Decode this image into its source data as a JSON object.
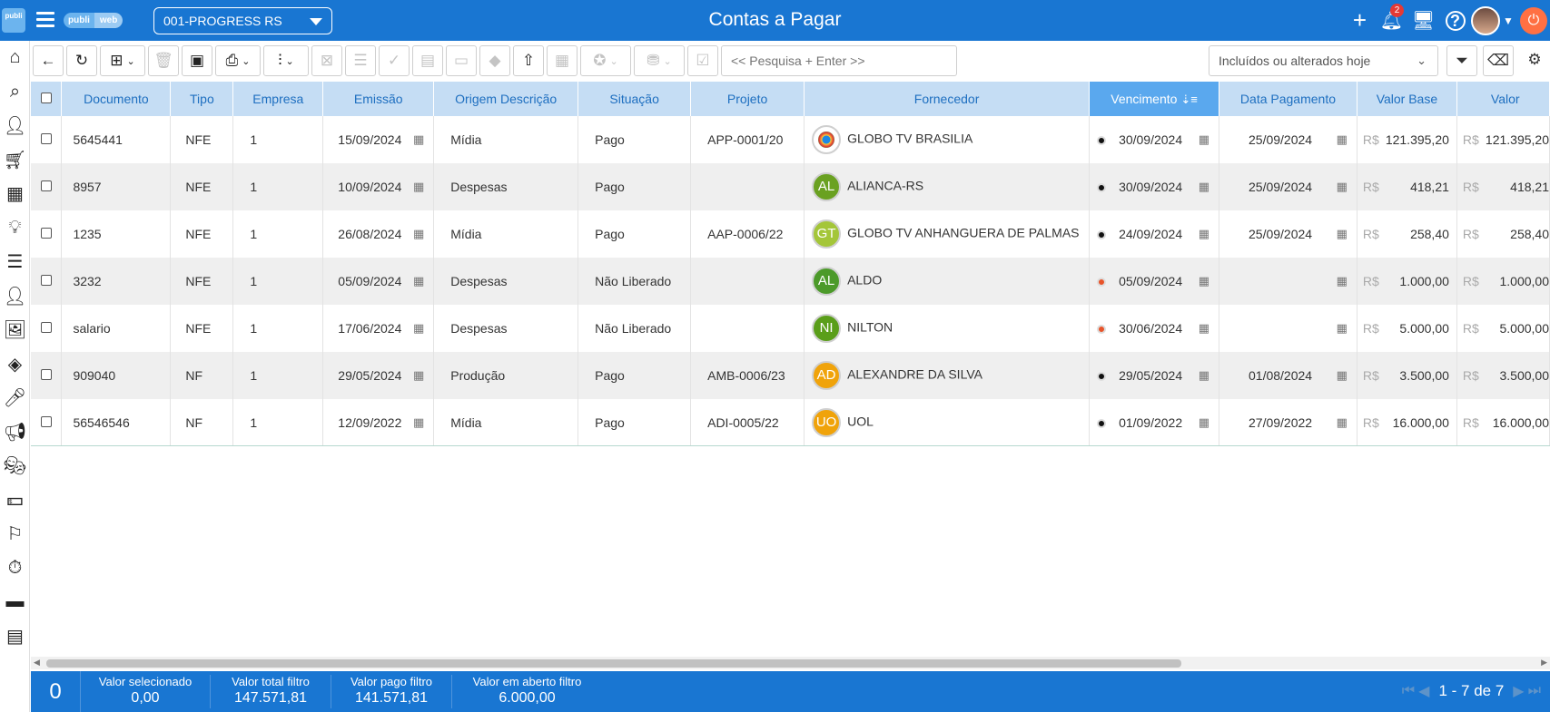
{
  "header": {
    "logo_text": "publi",
    "brand_part1": "publi",
    "brand_part2": "web",
    "company": "001-PROGRESS RS",
    "title": "Contas a Pagar",
    "notification_count": "2"
  },
  "sidebar_icons": [
    "home-icon",
    "home-search-icon",
    "add-user-icon",
    "cart-icon",
    "dashboard-icon",
    "lightbulb-icon",
    "list-icon",
    "person-icon",
    "images-icon",
    "paint-bucket-icon",
    "microphone-icon",
    "megaphone-icon",
    "theater-masks-icon",
    "money-bill-icon",
    "flag-icon",
    "stopwatch-icon",
    "wallet-icon",
    "calculator-icon"
  ],
  "toolbar": {
    "search_placeholder": "<< Pesquisa + Enter >>",
    "filter_value": "Incluídos ou alterados hoje"
  },
  "columns": [
    "Documento",
    "Tipo",
    "Empresa",
    "Emissão",
    "Origem Descrição",
    "Situação",
    "Projeto",
    "Fornecedor",
    "Vencimento",
    "Data Pagamento",
    "Valor Base",
    "Valor"
  ],
  "currency": "R$",
  "rows": [
    {
      "doc": "5645441",
      "tipo": "NFE",
      "empresa": "1",
      "emissao": "15/09/2024",
      "origem": "Mídia",
      "situacao": "Pago",
      "projeto": "APP-0001/20",
      "initials": "",
      "avatar_color": "#ffffff",
      "fornecedor": "GLOBO TV BRASILIA",
      "status_color": "#111111",
      "vencimento": "30/09/2024",
      "pagamento": "25/09/2024",
      "valor_base": "121.395,20",
      "valor": "121.395,20"
    },
    {
      "doc": "8957",
      "tipo": "NFE",
      "empresa": "1",
      "emissao": "10/09/2024",
      "origem": "Despesas",
      "situacao": "Pago",
      "projeto": "",
      "initials": "AL",
      "avatar_color": "#6aa121",
      "fornecedor": "ALIANCA-RS",
      "status_color": "#111111",
      "vencimento": "30/09/2024",
      "pagamento": "25/09/2024",
      "valor_base": "418,21",
      "valor": "418,21"
    },
    {
      "doc": "1235",
      "tipo": "NFE",
      "empresa": "1",
      "emissao": "26/08/2024",
      "origem": "Mídia",
      "situacao": "Pago",
      "projeto": "AAP-0006/22",
      "initials": "GT",
      "avatar_color": "#a4c639",
      "fornecedor": "GLOBO TV ANHANGUERA DE PALMAS",
      "status_color": "#111111",
      "vencimento": "24/09/2024",
      "pagamento": "25/09/2024",
      "valor_base": "258,40",
      "valor": "258,40"
    },
    {
      "doc": "3232",
      "tipo": "NFE",
      "empresa": "1",
      "emissao": "05/09/2024",
      "origem": "Despesas",
      "situacao": "Não Liberado",
      "projeto": "",
      "initials": "AL",
      "avatar_color": "#4c9a2a",
      "fornecedor": "ALDO",
      "status_color": "#e8542a",
      "vencimento": "05/09/2024",
      "pagamento": "",
      "valor_base": "1.000,00",
      "valor": "1.000,00"
    },
    {
      "doc": "salario",
      "tipo": "NFE",
      "empresa": "1",
      "emissao": "17/06/2024",
      "origem": "Despesas",
      "situacao": "Não Liberado",
      "projeto": "",
      "initials": "NI",
      "avatar_color": "#5a9e1a",
      "fornecedor": "NILTON",
      "status_color": "#e8542a",
      "vencimento": "30/06/2024",
      "pagamento": "",
      "valor_base": "5.000,00",
      "valor": "5.000,00"
    },
    {
      "doc": "909040",
      "tipo": "NF",
      "empresa": "1",
      "emissao": "29/05/2024",
      "origem": "Produção",
      "situacao": "Pago",
      "projeto": "AMB-0006/23",
      "initials": "AD",
      "avatar_color": "#f0a30a",
      "fornecedor": "ALEXANDRE DA SILVA",
      "status_color": "#111111",
      "vencimento": "29/05/2024",
      "pagamento": "01/08/2024",
      "valor_base": "3.500,00",
      "valor": "3.500,00"
    },
    {
      "doc": "56546546",
      "tipo": "NF",
      "empresa": "1",
      "emissao": "12/09/2022",
      "origem": "Mídia",
      "situacao": "Pago",
      "projeto": "ADI-0005/22",
      "initials": "UO",
      "avatar_color": "#f0a30a",
      "fornecedor": "UOL",
      "status_color": "#111111",
      "vencimento": "01/09/2022",
      "pagamento": "27/09/2022",
      "valor_base": "16.000,00",
      "valor": "16.000,00"
    }
  ],
  "footer": {
    "count": "0",
    "valor_selecionado_label": "Valor selecionado",
    "valor_selecionado": "0,00",
    "valor_total_label": "Valor total filtro",
    "valor_total": "147.571,81",
    "valor_pago_label": "Valor pago filtro",
    "valor_pago": "141.571,81",
    "valor_aberto_label": "Valor em aberto filtro",
    "valor_aberto": "6.000,00",
    "pagination": "1 - 7 de 7"
  }
}
